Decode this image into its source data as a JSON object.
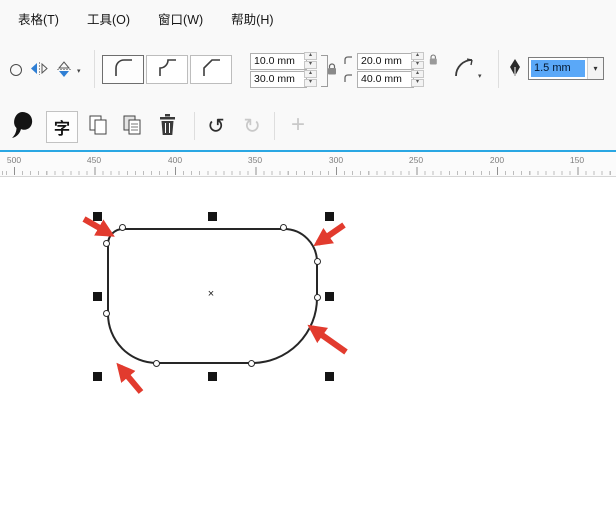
{
  "menu": {
    "items": [
      {
        "label": "表格(T)"
      },
      {
        "label": "工具(O)"
      },
      {
        "label": "窗口(W)"
      },
      {
        "label": "帮助(H)"
      }
    ]
  },
  "property_bar": {
    "corner_radius": {
      "top_left": "10.0 mm",
      "bottom_left": "30.0 mm",
      "top_right": "20.0 mm",
      "bottom_right": "40.0 mm"
    },
    "outline_width_value": "1.5 mm"
  },
  "toolbar2": {
    "text_button_label": "字"
  },
  "ruler": {
    "labels": [
      "500",
      "450",
      "400",
      "350",
      "300",
      "250",
      "200",
      "150"
    ]
  },
  "canvas": {
    "center_marker": "×"
  },
  "icons": {
    "spinner_up": "▴",
    "spinner_down": "▾",
    "dropdown": "▾",
    "undo": "↺",
    "redo": "↻",
    "plus": "+"
  },
  "colors": {
    "selection_highlight": "#5aa8f8",
    "annotation_arrow": "#e23b2e",
    "ruler_accent": "#2aa7e3"
  }
}
